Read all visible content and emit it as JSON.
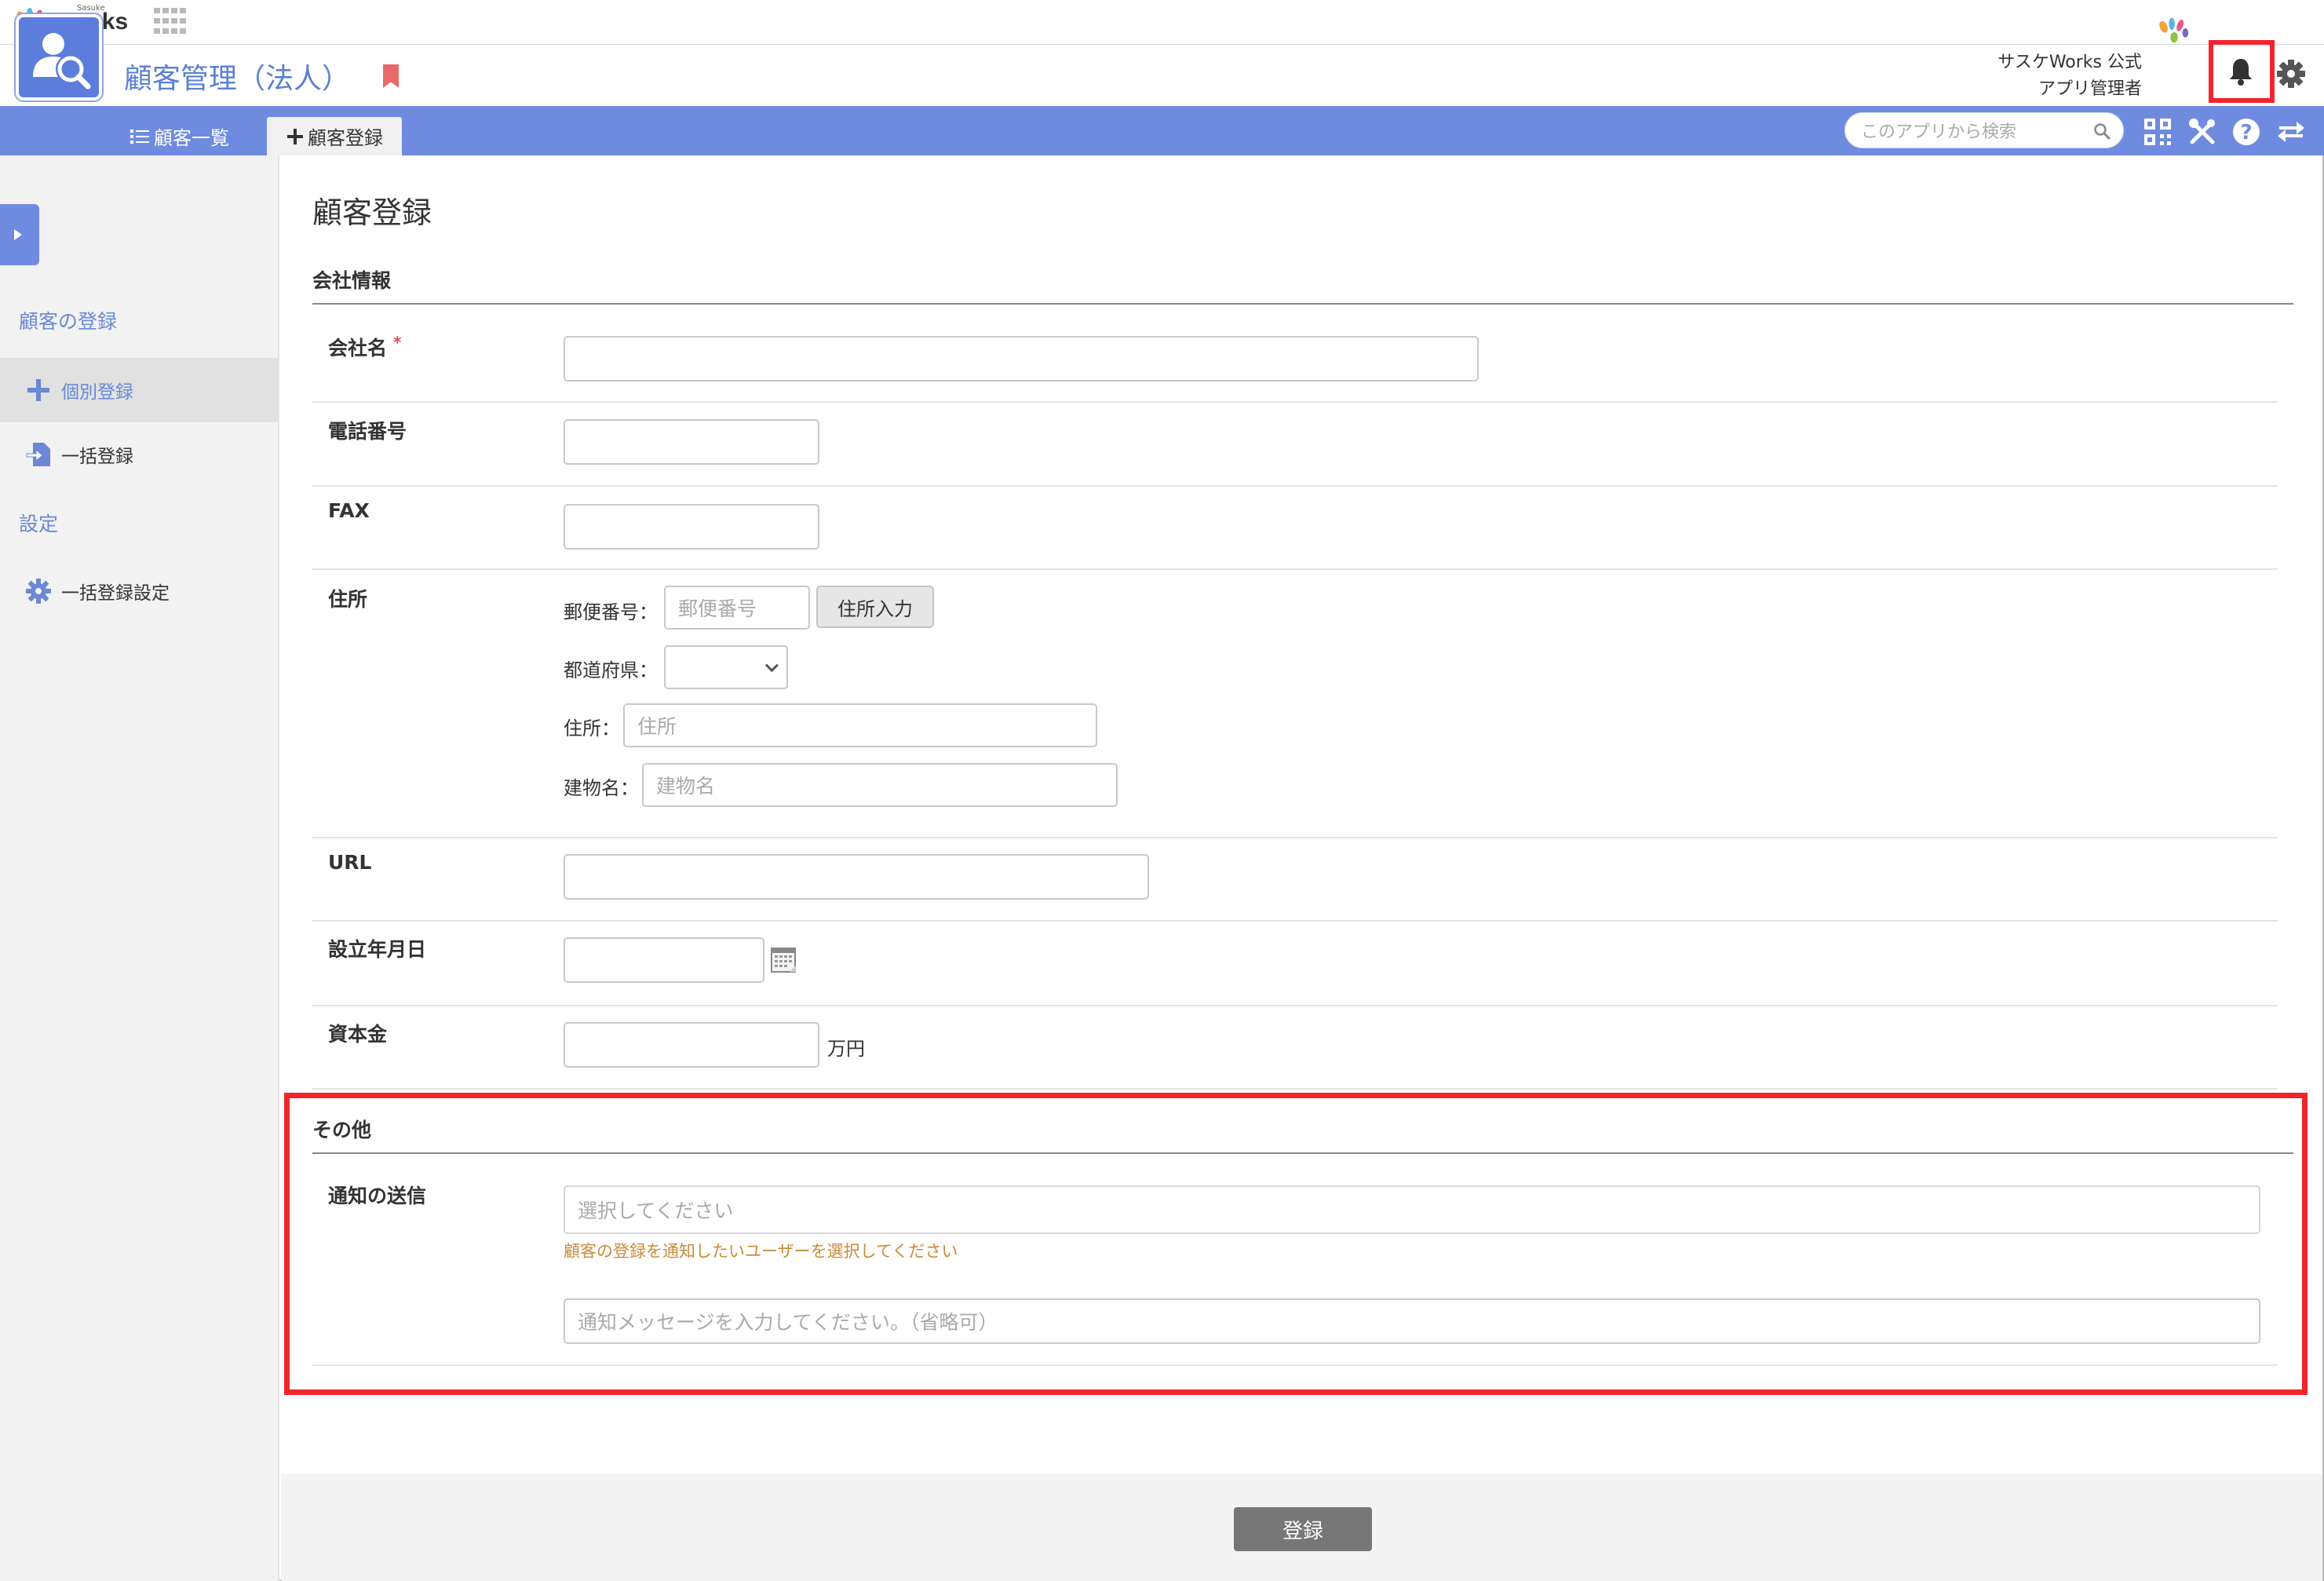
{
  "topbar": {
    "logo_small": "Sasuke",
    "logo_text": "Works"
  },
  "header": {
    "app_title": "顧客管理（法人）",
    "user_org": "サスケWorks 公式",
    "user_role": "アプリ管理者"
  },
  "tabs": {
    "list_label": "顧客一覧",
    "add_label": "顧客登録"
  },
  "search": {
    "placeholder": "このアプリから検索"
  },
  "sidebar": {
    "section1": "顧客の登録",
    "item_individual": "個別登録",
    "item_bulk": "一括登録",
    "section2": "設定",
    "item_bulk_settings": "一括登録設定"
  },
  "main": {
    "page_title": "顧客登録",
    "section_company": "会社情報",
    "section_other": "その他",
    "fields": {
      "company_name": "会社名",
      "required_mark": "*",
      "phone": "電話番号",
      "fax": "FAX",
      "address": "住所",
      "postal_label": "郵便番号：",
      "postal_placeholder": "郵便番号",
      "address_button": "住所入力",
      "prefecture_label": "都道府県：",
      "address_label": "住所：",
      "address_placeholder": "住所",
      "building_label": "建物名：",
      "building_placeholder": "建物名",
      "url": "URL",
      "founded": "設立年月日",
      "capital": "資本金",
      "capital_unit": "万円",
      "notify": "通知の送信",
      "notify_select_placeholder": "選択してください",
      "notify_hint": "顧客の登録を通知したいユーザーを選択してください",
      "notify_message_placeholder": "通知メッセージを入力してください。（省略可）"
    }
  },
  "footer": {
    "submit_label": "登録"
  },
  "colors": {
    "accent": "#6f8be0",
    "highlight": "#f1252b",
    "hint": "#c98b3a"
  }
}
